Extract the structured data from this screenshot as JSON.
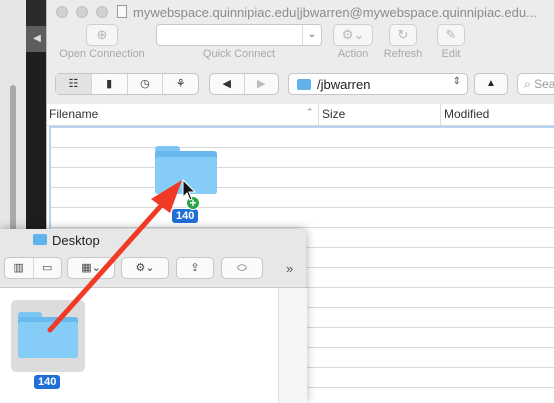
{
  "cyberduck": {
    "title": "mywebspace.quinnipiac.edu|jbwarren@mywebspace.quinnipiac.edu...",
    "toolbar": {
      "open_connection_label": "Open Connection",
      "quick_connect_label": "Quick Connect",
      "quick_connect_value": "",
      "action_label": "Action",
      "refresh_label": "Refresh",
      "edit_label": "Edit"
    },
    "navbar": {
      "path": "/jbwarren",
      "search_placeholder": "Search"
    },
    "columns": [
      "Filename",
      "Size",
      "Modified"
    ]
  },
  "drag": {
    "item_count": "140"
  },
  "finder": {
    "title": "Desktop",
    "item_count": "140"
  },
  "colors": {
    "arrow": "#f03a26",
    "folder": "#6ab9ee",
    "badge": "#1f6fd6",
    "plus": "#2aa54a",
    "drop_highlight": "#b7d4f3"
  }
}
